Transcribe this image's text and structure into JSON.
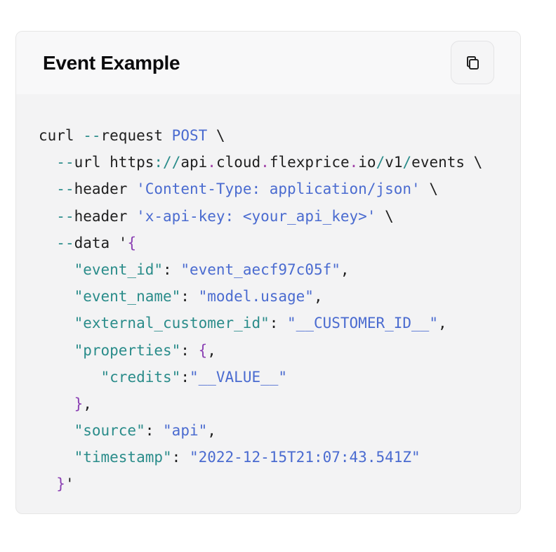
{
  "card": {
    "title": "Event Example",
    "copy_icon": "copy-icon"
  },
  "code": {
    "language": "bash",
    "text": "curl --request POST \\\n  --url https://api.cloud.flexprice.io/v1/events \\\n  --header 'Content-Type: application/json' \\\n  --header 'x-api-key: <your_api_key>' \\\n  --data '{\n    \"event_id\": \"event_aecf97c05f\",\n    \"event_name\": \"model.usage\",\n    \"external_customer_id\": \"__CUSTOMER_ID__\",\n    \"properties\": {,\n       \"credits\":\"__VALUE__\"\n    },\n    \"source\": \"api\",\n    \"timestamp\": \"2022-12-15T21:07:43.541Z\"\n  }'",
    "lines": [
      [
        {
          "t": "curl ",
          "c": "pl"
        },
        {
          "t": "--",
          "c": "op"
        },
        {
          "t": "request ",
          "c": "pl"
        },
        {
          "t": "POST",
          "c": "kw"
        },
        {
          "t": " \\",
          "c": "pl"
        }
      ],
      [
        {
          "t": "  ",
          "c": "pl"
        },
        {
          "t": "--",
          "c": "op"
        },
        {
          "t": "url https",
          "c": "pl"
        },
        {
          "t": ":",
          "c": "op"
        },
        {
          "t": "//",
          "c": "slash"
        },
        {
          "t": "api",
          "c": "pl"
        },
        {
          "t": ".",
          "c": "dot"
        },
        {
          "t": "cloud",
          "c": "pl"
        },
        {
          "t": ".",
          "c": "dot"
        },
        {
          "t": "flexprice",
          "c": "pl"
        },
        {
          "t": ".",
          "c": "dot"
        },
        {
          "t": "io",
          "c": "pl"
        },
        {
          "t": "/",
          "c": "slash"
        },
        {
          "t": "v1",
          "c": "pl"
        },
        {
          "t": "/",
          "c": "slash"
        },
        {
          "t": "events \\",
          "c": "pl"
        }
      ],
      [
        {
          "t": "  ",
          "c": "pl"
        },
        {
          "t": "--",
          "c": "op"
        },
        {
          "t": "header ",
          "c": "pl"
        },
        {
          "t": "'Content-Type: application/json'",
          "c": "str"
        },
        {
          "t": " \\",
          "c": "pl"
        }
      ],
      [
        {
          "t": "  ",
          "c": "pl"
        },
        {
          "t": "--",
          "c": "op"
        },
        {
          "t": "header ",
          "c": "pl"
        },
        {
          "t": "'x-api-key: <your_api_key>'",
          "c": "str"
        },
        {
          "t": " \\",
          "c": "pl"
        }
      ],
      [
        {
          "t": "  ",
          "c": "pl"
        },
        {
          "t": "--",
          "c": "op"
        },
        {
          "t": "data '",
          "c": "pl"
        },
        {
          "t": "{",
          "c": "brace"
        }
      ],
      [
        {
          "t": "    ",
          "c": "pl"
        },
        {
          "t": "\"event_id\"",
          "c": "key"
        },
        {
          "t": ": ",
          "c": "pl"
        },
        {
          "t": "\"event_aecf97c05f\"",
          "c": "str"
        },
        {
          "t": ",",
          "c": "pl"
        }
      ],
      [
        {
          "t": "    ",
          "c": "pl"
        },
        {
          "t": "\"event_name\"",
          "c": "key"
        },
        {
          "t": ": ",
          "c": "pl"
        },
        {
          "t": "\"model.usage\"",
          "c": "str"
        },
        {
          "t": ",",
          "c": "pl"
        }
      ],
      [
        {
          "t": "    ",
          "c": "pl"
        },
        {
          "t": "\"external_customer_id\"",
          "c": "key"
        },
        {
          "t": ": ",
          "c": "pl"
        },
        {
          "t": "\"__CUSTOMER_ID__\"",
          "c": "str"
        },
        {
          "t": ",",
          "c": "pl"
        }
      ],
      [
        {
          "t": "    ",
          "c": "pl"
        },
        {
          "t": "\"properties\"",
          "c": "key"
        },
        {
          "t": ": ",
          "c": "pl"
        },
        {
          "t": "{",
          "c": "brace"
        },
        {
          "t": ",",
          "c": "pl"
        }
      ],
      [
        {
          "t": "       ",
          "c": "pl"
        },
        {
          "t": "\"credits\"",
          "c": "key"
        },
        {
          "t": ":",
          "c": "pl"
        },
        {
          "t": "\"__VALUE__\"",
          "c": "str"
        }
      ],
      [
        {
          "t": "    ",
          "c": "pl"
        },
        {
          "t": "}",
          "c": "brace"
        },
        {
          "t": ",",
          "c": "pl"
        }
      ],
      [
        {
          "t": "    ",
          "c": "pl"
        },
        {
          "t": "\"source\"",
          "c": "key"
        },
        {
          "t": ": ",
          "c": "pl"
        },
        {
          "t": "\"api\"",
          "c": "str"
        },
        {
          "t": ",",
          "c": "pl"
        }
      ],
      [
        {
          "t": "    ",
          "c": "pl"
        },
        {
          "t": "\"timestamp\"",
          "c": "key"
        },
        {
          "t": ": ",
          "c": "pl"
        },
        {
          "t": "\"2022-12-15T21:07:43.541Z\"",
          "c": "str"
        }
      ],
      [
        {
          "t": "  ",
          "c": "pl"
        },
        {
          "t": "}",
          "c": "brace"
        },
        {
          "t": "'",
          "c": "pl"
        }
      ]
    ]
  },
  "colors": {
    "keyword": "#4a6bd0",
    "operator": "#2a8c8a",
    "string": "#4a6bd0",
    "key": "#2a8c8a",
    "brace": "#8a3fb3",
    "plain": "#1f1f1f",
    "card_bg": "#f3f3f4",
    "header_bg": "#f8f8f9"
  }
}
